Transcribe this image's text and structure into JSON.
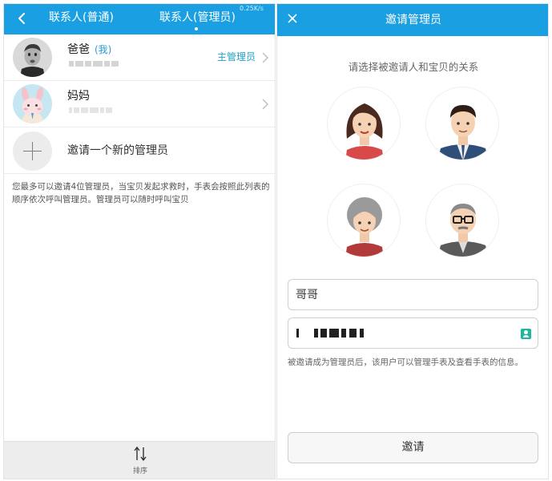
{
  "left_screen": {
    "header": {
      "tabs": [
        {
          "label": "联系人(普通)",
          "active": false
        },
        {
          "label": "联系人(管理员)",
          "active": true
        }
      ],
      "network_speed": "0.25K/s"
    },
    "admins": [
      {
        "name": "爸爸",
        "tag": "(我)",
        "role": "主管理员",
        "avatar": "man-photo-avatar"
      },
      {
        "name": "妈妈",
        "tag": "",
        "role": "",
        "avatar": "cartoon-bunny-avatar"
      }
    ],
    "invite_new_label": "邀请一个新的管理员",
    "notice": "您最多可以邀请4位管理员，当宝贝发起求救时，手表会按照此列表的顺序依次呼叫管理员。管理员可以随时呼叫宝贝",
    "bottom_bar": {
      "sort_label": "排序",
      "sort_icon": "sort-arrows-icon"
    }
  },
  "right_screen": {
    "header": {
      "title": "邀请管理员",
      "close_icon": "close-icon"
    },
    "prompt": "请选择被邀请人和宝贝的关系",
    "relations": [
      {
        "icon": "woman-avatar-icon"
      },
      {
        "icon": "man-avatar-icon"
      },
      {
        "icon": "grandma-avatar-icon"
      },
      {
        "icon": "grandpa-avatar-icon"
      }
    ],
    "relation_input": {
      "value": "哥哥"
    },
    "phone_input": {
      "contact_icon": "contact-book-icon"
    },
    "note": "被邀请成为管理员后，该用户可以管理手表及查看手表的信息。",
    "invite_button": "邀请"
  },
  "colors": {
    "header_blue": "#1a9fe3",
    "role_teal": "#20a0c8",
    "contact_icon_green": "#20b5a0"
  }
}
